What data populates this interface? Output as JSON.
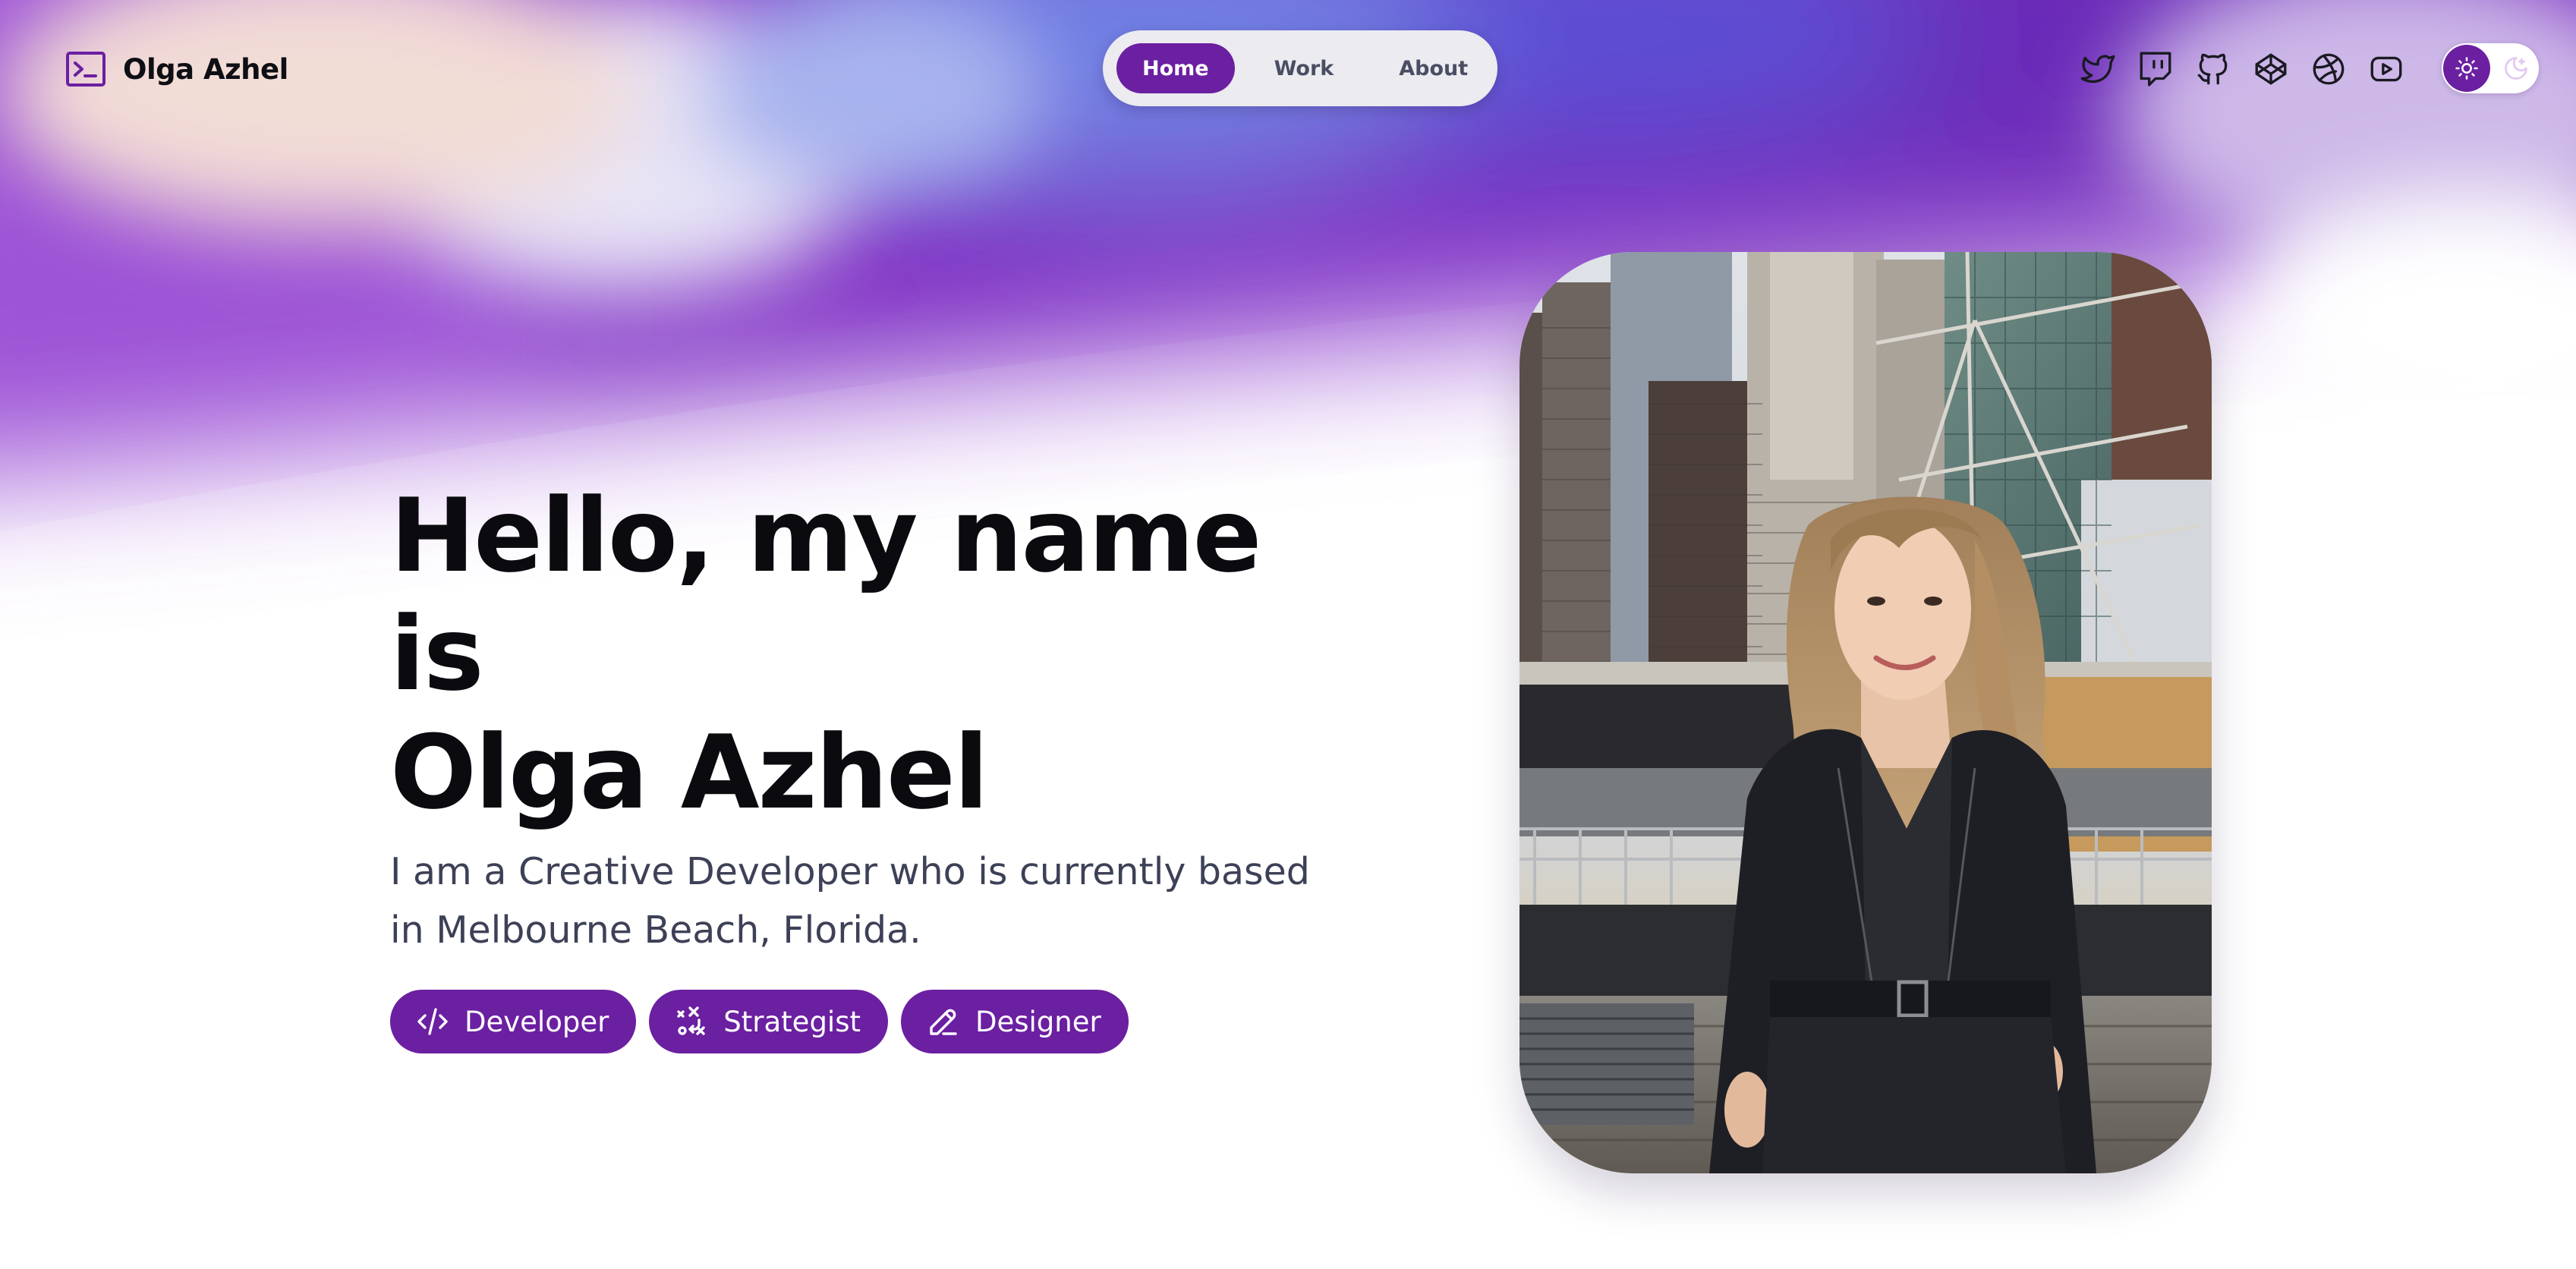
{
  "brand": {
    "name": "Olga Azhel",
    "icon": "terminal-icon"
  },
  "nav": {
    "items": [
      {
        "label": "Home",
        "active": true
      },
      {
        "label": "Work",
        "active": false
      },
      {
        "label": "About",
        "active": false
      }
    ]
  },
  "socials": [
    {
      "name": "twitter",
      "icon": "twitter-icon"
    },
    {
      "name": "twitch",
      "icon": "twitch-icon"
    },
    {
      "name": "github",
      "icon": "github-icon"
    },
    {
      "name": "codepen",
      "icon": "codepen-icon"
    },
    {
      "name": "dribbble",
      "icon": "dribbble-icon"
    },
    {
      "name": "youtube",
      "icon": "youtube-icon"
    }
  ],
  "theme_toggle": {
    "mode": "light",
    "icons": [
      "sun-icon",
      "moon-icon"
    ]
  },
  "hero": {
    "title_line1": "Hello, my name is",
    "title_line2": "Olga Azhel",
    "subtitle": "I am a Creative Developer who is currently based in Melbourne Beach, Florida.",
    "roles": [
      {
        "label": "Developer",
        "icon": "code-icon"
      },
      {
        "label": "Strategist",
        "icon": "strategy-icon"
      },
      {
        "label": "Designer",
        "icon": "pencil-icon"
      }
    ]
  },
  "colors": {
    "accent": "#6b1fa1",
    "text_dark": "#0a0a0f",
    "text_muted": "#3d4157",
    "nav_bg": "#ebebf0",
    "gradient_purple": "#7a2fc4",
    "gradient_blue": "#6b7fe0",
    "gradient_peach": "#f3d6d0"
  }
}
